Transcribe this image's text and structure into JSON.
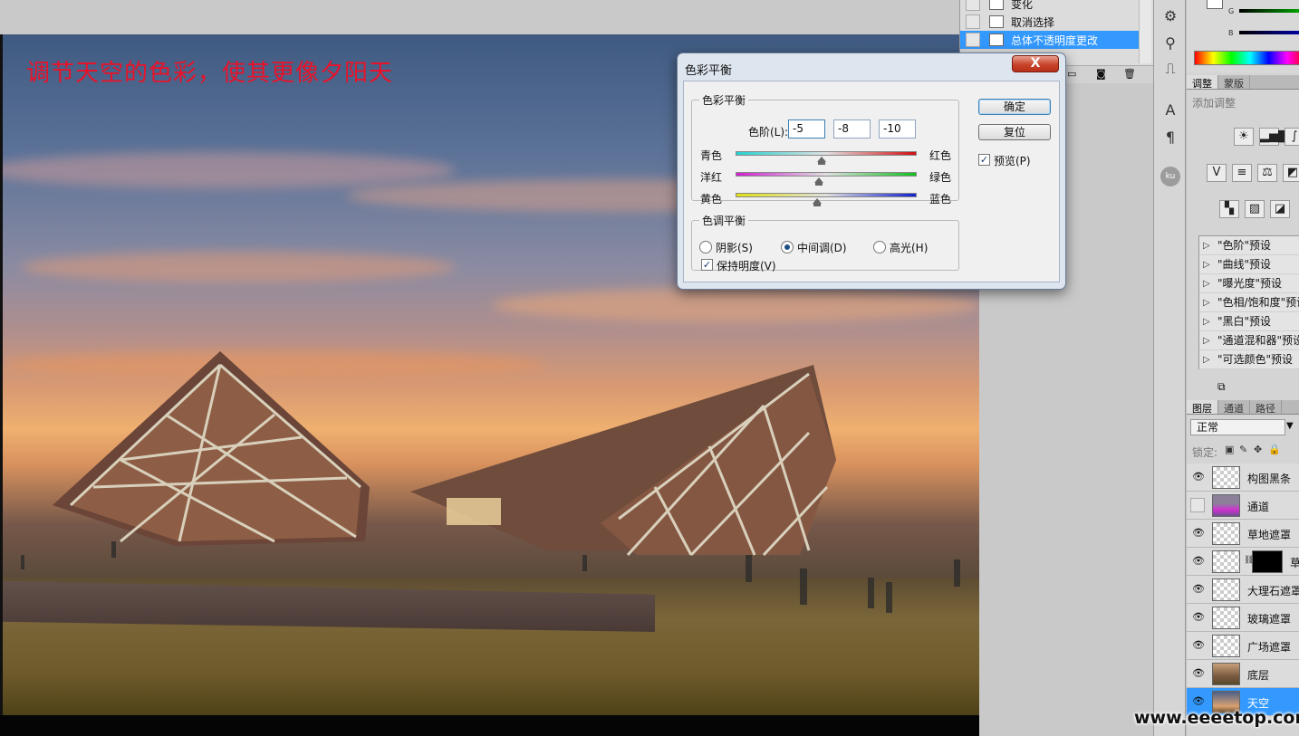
{
  "canvas": {
    "caption": "调节天空的色彩，使其更像夕阳天",
    "caption_color": "#e8132a"
  },
  "history": {
    "items": [
      {
        "label": "变化",
        "icon": "history-state-icon"
      },
      {
        "label": "取消选择",
        "icon": "history-state-icon"
      },
      {
        "label": "总体不透明度更改",
        "icon": "history-state-icon",
        "active": true
      }
    ]
  },
  "tool_strip": {
    "icons": [
      "sliders-icon",
      "puppet-icon",
      "stamp-icon",
      "character-icon",
      "paragraph-icon",
      "ku-icon"
    ],
    "ku_label": "ku"
  },
  "color_panel": {
    "g_label": "G",
    "b_label": "B"
  },
  "adjustments": {
    "tabs": [
      "调整",
      "蒙版"
    ],
    "title": "添加调整",
    "presets": [
      "\"色阶\"预设",
      "\"曲线\"预设",
      "\"曝光度\"预设",
      "\"色相/饱和度\"预设",
      "\"黑白\"预设",
      "\"通道混和器\"预设",
      "\"可选颜色\"预设"
    ]
  },
  "layers": {
    "tabs": [
      "图层",
      "通道",
      "路径"
    ],
    "blend_mode": "正常",
    "lock_label": "锁定:",
    "items": [
      {
        "name": "构图黑条",
        "visible": true
      },
      {
        "name": "通道",
        "visible": false
      },
      {
        "name": "草地遮罩",
        "visible": true
      },
      {
        "name": "草",
        "visible": true
      },
      {
        "name": "大理石遮罩",
        "visible": true
      },
      {
        "name": "玻璃遮罩",
        "visible": true
      },
      {
        "name": "广场遮罩",
        "visible": true
      },
      {
        "name": "底层",
        "visible": true
      },
      {
        "name": "天空",
        "visible": true,
        "active": true
      }
    ]
  },
  "dialog": {
    "title": "色彩平衡",
    "close_glyph": "X",
    "color_balance_group": "色彩平衡",
    "levels_label": "色阶(L):",
    "levels": [
      "-5",
      "-8",
      "-10"
    ],
    "sliders": [
      {
        "left": "青色",
        "right": "红色",
        "value": -5
      },
      {
        "left": "洋红",
        "right": "绿色",
        "value": -8
      },
      {
        "left": "黄色",
        "right": "蓝色",
        "value": -10
      }
    ],
    "tone_group": "色调平衡",
    "tones": [
      {
        "label": "阴影(S)",
        "selected": false
      },
      {
        "label": "中间调(D)",
        "selected": true
      },
      {
        "label": "高光(H)",
        "selected": false
      }
    ],
    "preserve_luminosity": "保持明度(V)",
    "preserve_checked": true,
    "ok_label": "确定",
    "reset_label": "复位",
    "preview_label": "预览(P)",
    "preview_checked": true
  },
  "watermark": "www.eeeetop.com"
}
